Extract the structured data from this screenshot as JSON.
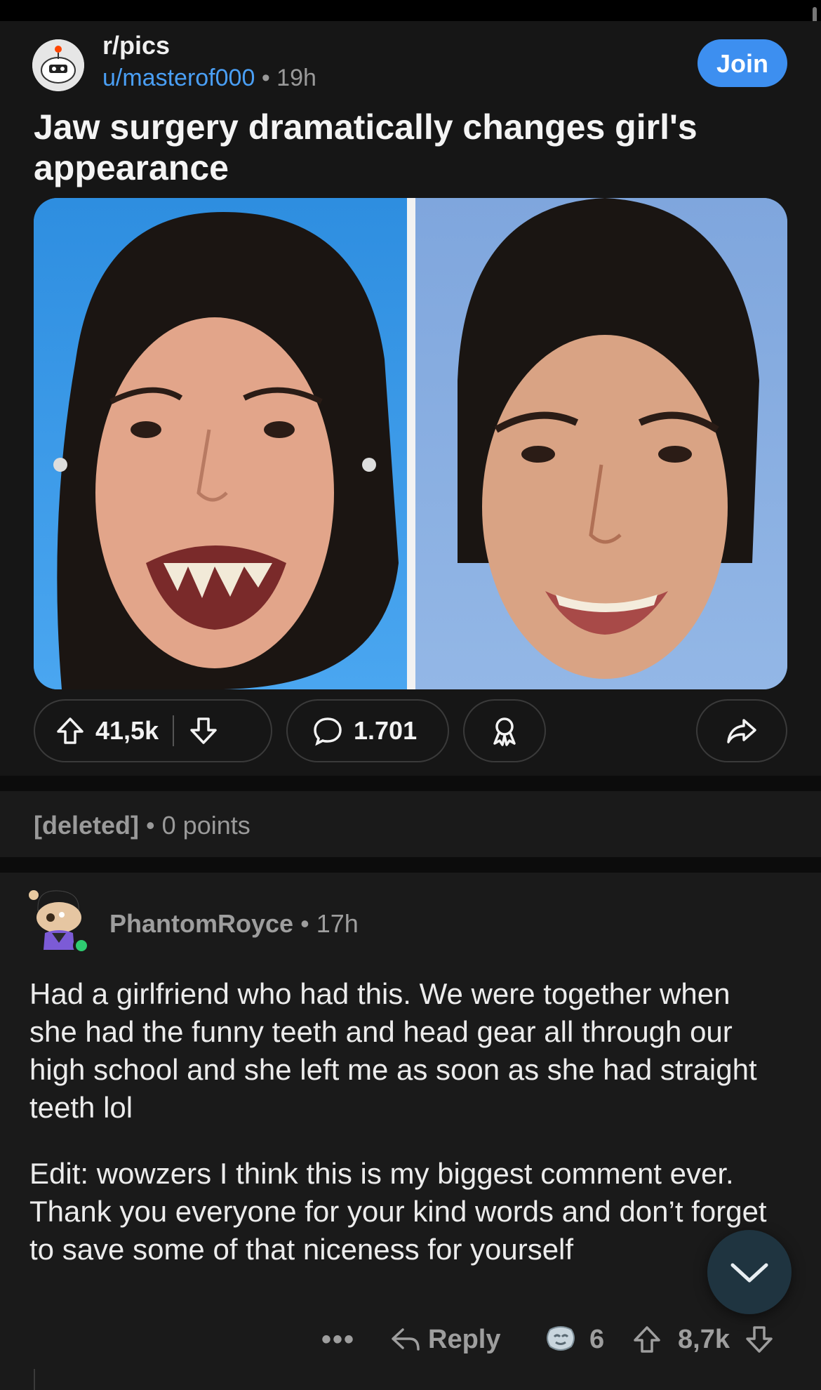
{
  "post": {
    "subreddit": "r/pics",
    "author": "u/masterof000",
    "separator": "•",
    "age": "19h",
    "join_label": "Join",
    "title": "Jaw surgery dramatically changes girl's appearance",
    "upvotes": "41,5k",
    "comments": "1.701"
  },
  "deleted_comment": {
    "author": "[deleted]",
    "separator": "•",
    "points": "0 points"
  },
  "comment": {
    "author": "PhantomRoyce",
    "separator": "•",
    "age": "17h",
    "paragraphs": [
      "Had a girlfriend who had this. We were together when she had the funny teeth and head gear all through our high school and she left me as soon as she had straight teeth lol",
      "Edit: wowzers I think this is my biggest comment ever. Thank you everyone for your kind words and don’t forget to save some of that niceness for yourself"
    ],
    "more_label": "•••",
    "reply_label": "Reply",
    "award_count": "6",
    "votes": "8,7k"
  },
  "icons": {
    "upvote": "arrow-up-icon",
    "downvote": "arrow-down-icon",
    "comment": "speech-bubble-icon",
    "award": "award-ribbon-icon",
    "share": "share-arrow-icon",
    "reply": "reply-arrow-icon",
    "scroll": "chevron-down-icon"
  },
  "colors": {
    "accent": "#3d8ff0",
    "username_link": "#4a9ff5",
    "online": "#2ecc71"
  }
}
